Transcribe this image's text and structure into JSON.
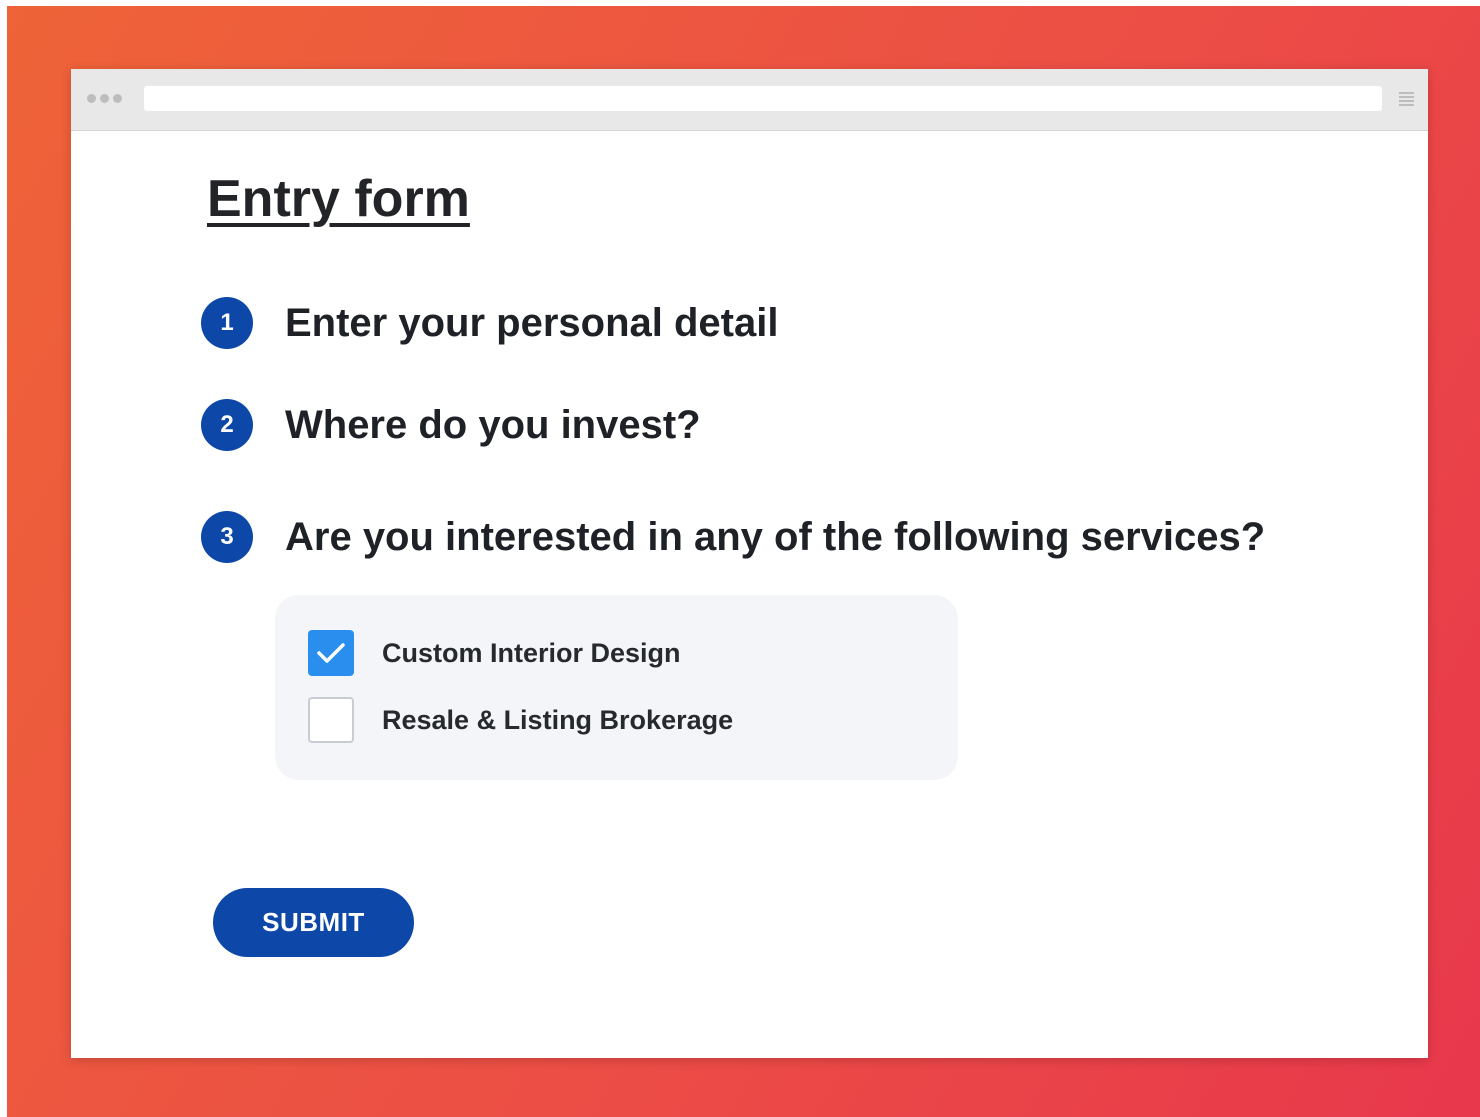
{
  "browser": {
    "address_bar_value": ""
  },
  "form": {
    "title": "Entry form",
    "steps": [
      {
        "number": "1",
        "label": "Enter your personal detail"
      },
      {
        "number": "2",
        "label": "Where do you invest?"
      },
      {
        "number": "3",
        "label": "Are you interested in any of the following services?"
      }
    ],
    "services": [
      {
        "label": "Custom Interior Design",
        "checked": true
      },
      {
        "label": "Resale & Listing Brokerage",
        "checked": false
      }
    ],
    "submit_label": "SUBMIT"
  },
  "colors": {
    "accent_blue": "#0d47a8",
    "checkbox_checked": "#2a8eef",
    "background_gradient_start": "#ee6338",
    "background_gradient_end": "#e8384c"
  },
  "icons": {
    "window_controls": "three-dots-icon",
    "browser_menu": "hamburger-menu-icon",
    "checked_state": "checkmark-icon"
  }
}
